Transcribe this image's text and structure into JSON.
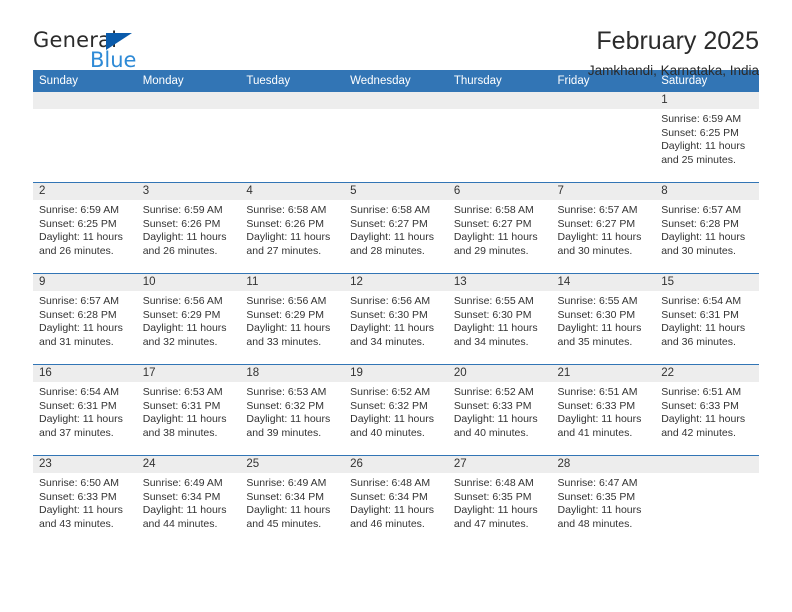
{
  "brand": {
    "name_top": "General",
    "name_bottom": "Blue",
    "triangle_icon": "blue-triangle-icon",
    "accent_color": "#0a5bab",
    "blue_text_color": "#2e8ad6"
  },
  "header": {
    "title": "February 2025",
    "subtitle": "Jamkhandi, Karnataka, India"
  },
  "theme": {
    "header_blue": "#3275b5",
    "daynum_band": "#ededed",
    "text": "#333333"
  },
  "columns": [
    "Sunday",
    "Monday",
    "Tuesday",
    "Wednesday",
    "Thursday",
    "Friday",
    "Saturday"
  ],
  "labels": {
    "sunrise_prefix": "Sunrise:",
    "sunset_prefix": "Sunset:",
    "daylight_prefix": "Daylight:"
  },
  "weeks": [
    [
      {
        "empty": true
      },
      {
        "empty": true
      },
      {
        "empty": true
      },
      {
        "empty": true
      },
      {
        "empty": true
      },
      {
        "empty": true
      },
      {
        "day": "1",
        "sunrise": "Sunrise: 6:59 AM",
        "sunset": "Sunset: 6:25 PM",
        "daylight1": "Daylight: 11 hours",
        "daylight2": "and 25 minutes."
      }
    ],
    [
      {
        "day": "2",
        "sunrise": "Sunrise: 6:59 AM",
        "sunset": "Sunset: 6:25 PM",
        "daylight1": "Daylight: 11 hours",
        "daylight2": "and 26 minutes."
      },
      {
        "day": "3",
        "sunrise": "Sunrise: 6:59 AM",
        "sunset": "Sunset: 6:26 PM",
        "daylight1": "Daylight: 11 hours",
        "daylight2": "and 26 minutes."
      },
      {
        "day": "4",
        "sunrise": "Sunrise: 6:58 AM",
        "sunset": "Sunset: 6:26 PM",
        "daylight1": "Daylight: 11 hours",
        "daylight2": "and 27 minutes."
      },
      {
        "day": "5",
        "sunrise": "Sunrise: 6:58 AM",
        "sunset": "Sunset: 6:27 PM",
        "daylight1": "Daylight: 11 hours",
        "daylight2": "and 28 minutes."
      },
      {
        "day": "6",
        "sunrise": "Sunrise: 6:58 AM",
        "sunset": "Sunset: 6:27 PM",
        "daylight1": "Daylight: 11 hours",
        "daylight2": "and 29 minutes."
      },
      {
        "day": "7",
        "sunrise": "Sunrise: 6:57 AM",
        "sunset": "Sunset: 6:27 PM",
        "daylight1": "Daylight: 11 hours",
        "daylight2": "and 30 minutes."
      },
      {
        "day": "8",
        "sunrise": "Sunrise: 6:57 AM",
        "sunset": "Sunset: 6:28 PM",
        "daylight1": "Daylight: 11 hours",
        "daylight2": "and 30 minutes."
      }
    ],
    [
      {
        "day": "9",
        "sunrise": "Sunrise: 6:57 AM",
        "sunset": "Sunset: 6:28 PM",
        "daylight1": "Daylight: 11 hours",
        "daylight2": "and 31 minutes."
      },
      {
        "day": "10",
        "sunrise": "Sunrise: 6:56 AM",
        "sunset": "Sunset: 6:29 PM",
        "daylight1": "Daylight: 11 hours",
        "daylight2": "and 32 minutes."
      },
      {
        "day": "11",
        "sunrise": "Sunrise: 6:56 AM",
        "sunset": "Sunset: 6:29 PM",
        "daylight1": "Daylight: 11 hours",
        "daylight2": "and 33 minutes."
      },
      {
        "day": "12",
        "sunrise": "Sunrise: 6:56 AM",
        "sunset": "Sunset: 6:30 PM",
        "daylight1": "Daylight: 11 hours",
        "daylight2": "and 34 minutes."
      },
      {
        "day": "13",
        "sunrise": "Sunrise: 6:55 AM",
        "sunset": "Sunset: 6:30 PM",
        "daylight1": "Daylight: 11 hours",
        "daylight2": "and 34 minutes."
      },
      {
        "day": "14",
        "sunrise": "Sunrise: 6:55 AM",
        "sunset": "Sunset: 6:30 PM",
        "daylight1": "Daylight: 11 hours",
        "daylight2": "and 35 minutes."
      },
      {
        "day": "15",
        "sunrise": "Sunrise: 6:54 AM",
        "sunset": "Sunset: 6:31 PM",
        "daylight1": "Daylight: 11 hours",
        "daylight2": "and 36 minutes."
      }
    ],
    [
      {
        "day": "16",
        "sunrise": "Sunrise: 6:54 AM",
        "sunset": "Sunset: 6:31 PM",
        "daylight1": "Daylight: 11 hours",
        "daylight2": "and 37 minutes."
      },
      {
        "day": "17",
        "sunrise": "Sunrise: 6:53 AM",
        "sunset": "Sunset: 6:31 PM",
        "daylight1": "Daylight: 11 hours",
        "daylight2": "and 38 minutes."
      },
      {
        "day": "18",
        "sunrise": "Sunrise: 6:53 AM",
        "sunset": "Sunset: 6:32 PM",
        "daylight1": "Daylight: 11 hours",
        "daylight2": "and 39 minutes."
      },
      {
        "day": "19",
        "sunrise": "Sunrise: 6:52 AM",
        "sunset": "Sunset: 6:32 PM",
        "daylight1": "Daylight: 11 hours",
        "daylight2": "and 40 minutes."
      },
      {
        "day": "20",
        "sunrise": "Sunrise: 6:52 AM",
        "sunset": "Sunset: 6:33 PM",
        "daylight1": "Daylight: 11 hours",
        "daylight2": "and 40 minutes."
      },
      {
        "day": "21",
        "sunrise": "Sunrise: 6:51 AM",
        "sunset": "Sunset: 6:33 PM",
        "daylight1": "Daylight: 11 hours",
        "daylight2": "and 41 minutes."
      },
      {
        "day": "22",
        "sunrise": "Sunrise: 6:51 AM",
        "sunset": "Sunset: 6:33 PM",
        "daylight1": "Daylight: 11 hours",
        "daylight2": "and 42 minutes."
      }
    ],
    [
      {
        "day": "23",
        "sunrise": "Sunrise: 6:50 AM",
        "sunset": "Sunset: 6:33 PM",
        "daylight1": "Daylight: 11 hours",
        "daylight2": "and 43 minutes."
      },
      {
        "day": "24",
        "sunrise": "Sunrise: 6:49 AM",
        "sunset": "Sunset: 6:34 PM",
        "daylight1": "Daylight: 11 hours",
        "daylight2": "and 44 minutes."
      },
      {
        "day": "25",
        "sunrise": "Sunrise: 6:49 AM",
        "sunset": "Sunset: 6:34 PM",
        "daylight1": "Daylight: 11 hours",
        "daylight2": "and 45 minutes."
      },
      {
        "day": "26",
        "sunrise": "Sunrise: 6:48 AM",
        "sunset": "Sunset: 6:34 PM",
        "daylight1": "Daylight: 11 hours",
        "daylight2": "and 46 minutes."
      },
      {
        "day": "27",
        "sunrise": "Sunrise: 6:48 AM",
        "sunset": "Sunset: 6:35 PM",
        "daylight1": "Daylight: 11 hours",
        "daylight2": "and 47 minutes."
      },
      {
        "day": "28",
        "sunrise": "Sunrise: 6:47 AM",
        "sunset": "Sunset: 6:35 PM",
        "daylight1": "Daylight: 11 hours",
        "daylight2": "and 48 minutes."
      },
      {
        "empty": true
      }
    ]
  ]
}
